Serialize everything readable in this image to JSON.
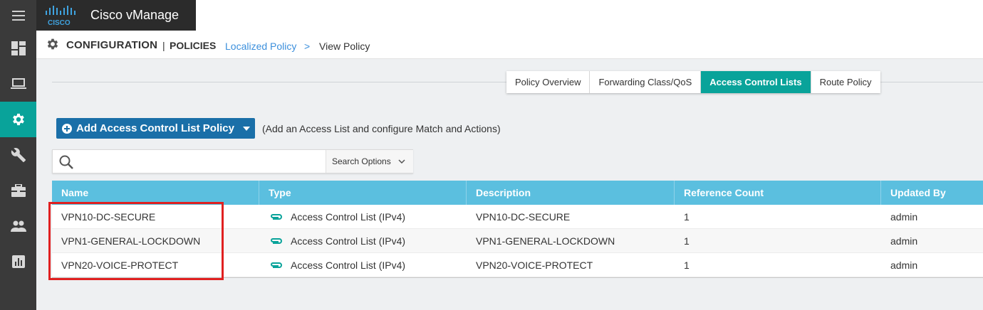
{
  "topbar": {
    "menu_icon": "hamburger-menu-icon",
    "logo_text": "CISCO",
    "app_title": "Cisco vManage"
  },
  "leftnav": {
    "items": [
      {
        "icon": "dashboard-icon",
        "active": false
      },
      {
        "icon": "monitor-icon",
        "active": false
      },
      {
        "icon": "gear-icon",
        "active": true
      },
      {
        "icon": "wrench-icon",
        "active": false
      },
      {
        "icon": "toolbox-icon",
        "active": false
      },
      {
        "icon": "users-icon",
        "active": false
      },
      {
        "icon": "bar-chart-icon",
        "active": false
      }
    ]
  },
  "header": {
    "section": "CONFIGURATION",
    "separator": "|",
    "subsection": "POLICIES",
    "breadcrumb_link": "Localized Policy",
    "breadcrumb_arrow": ">",
    "breadcrumb_current": "View Policy"
  },
  "tabs": [
    {
      "label": "Policy Overview",
      "active": false
    },
    {
      "label": "Forwarding Class/QoS",
      "active": false
    },
    {
      "label": "Access Control Lists",
      "active": true
    },
    {
      "label": "Route Policy",
      "active": false
    }
  ],
  "actions": {
    "add_label": "Add Access Control List Policy",
    "add_hint": "(Add an Access List and configure Match and Actions)"
  },
  "search": {
    "placeholder": "",
    "value": "",
    "options_label": "Search Options"
  },
  "table": {
    "columns": [
      "Name",
      "Type",
      "Description",
      "Reference Count",
      "Updated By"
    ],
    "rows": [
      {
        "name": "VPN10-DC-SECURE",
        "type": "Access Control List (IPv4)",
        "description": "VPN10-DC-SECURE",
        "reference_count": "1",
        "updated_by": "admin"
      },
      {
        "name": "VPN1-GENERAL-LOCKDOWN",
        "type": "Access Control List (IPv4)",
        "description": "VPN1-GENERAL-LOCKDOWN",
        "reference_count": "1",
        "updated_by": "admin"
      },
      {
        "name": "VPN20-VOICE-PROTECT",
        "type": "Access Control List (IPv4)",
        "description": "VPN20-VOICE-PROTECT",
        "reference_count": "1",
        "updated_by": "admin"
      }
    ]
  },
  "colors": {
    "accent_teal": "#09a39a",
    "header_blue": "#5bbfdf",
    "button_blue": "#1a6fa8",
    "link_blue": "#3b8fdc",
    "highlight_red": "#e02020"
  }
}
